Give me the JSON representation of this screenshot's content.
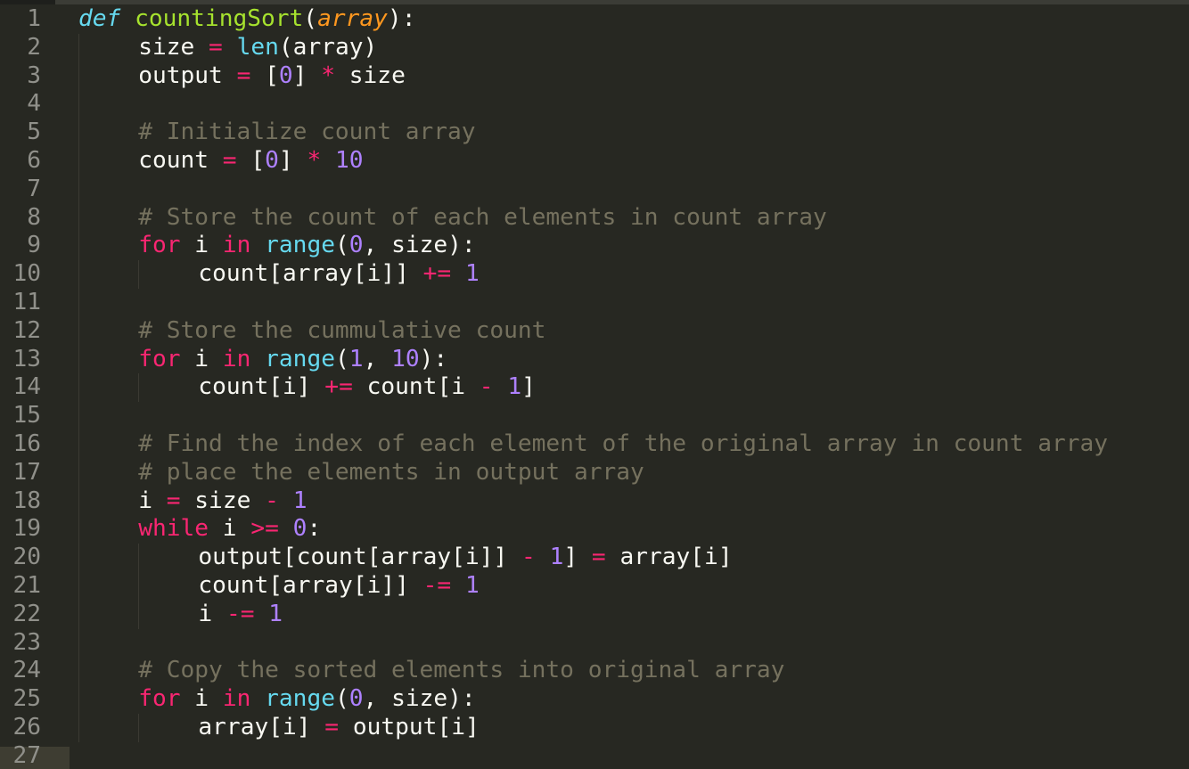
{
  "editor": {
    "theme_colors": {
      "background": "#272822",
      "keyword": "#F92672",
      "function": "#A6E22E",
      "builtin": "#66D9EF",
      "parameter": "#FD971F",
      "number": "#AE81FF",
      "comment": "#75715E",
      "text": "#F8F8F2",
      "line_number": "#90908a"
    },
    "current_line": 27,
    "lines": [
      {
        "n": "1",
        "indent": 0,
        "tokens": [
          [
            "def",
            "def"
          ],
          [
            "tx",
            " "
          ],
          [
            "fn",
            "countingSort"
          ],
          [
            "tx",
            "("
          ],
          [
            "param",
            "array"
          ],
          [
            "tx",
            "):"
          ]
        ]
      },
      {
        "n": "2",
        "indent": 1,
        "tokens": [
          [
            "tx",
            "size "
          ],
          [
            "op",
            "="
          ],
          [
            "tx",
            " "
          ],
          [
            "builtin",
            "len"
          ],
          [
            "tx",
            "(array)"
          ]
        ]
      },
      {
        "n": "3",
        "indent": 1,
        "tokens": [
          [
            "tx",
            "output "
          ],
          [
            "op",
            "="
          ],
          [
            "tx",
            " ["
          ],
          [
            "num",
            "0"
          ],
          [
            "tx",
            "] "
          ],
          [
            "op",
            "*"
          ],
          [
            "tx",
            " size"
          ]
        ]
      },
      {
        "n": "4",
        "indent": 1,
        "tokens": []
      },
      {
        "n": "5",
        "indent": 1,
        "tokens": [
          [
            "cm",
            "# Initialize count array"
          ]
        ]
      },
      {
        "n": "6",
        "indent": 1,
        "tokens": [
          [
            "tx",
            "count "
          ],
          [
            "op",
            "="
          ],
          [
            "tx",
            " ["
          ],
          [
            "num",
            "0"
          ],
          [
            "tx",
            "] "
          ],
          [
            "op",
            "*"
          ],
          [
            "tx",
            " "
          ],
          [
            "num",
            "10"
          ]
        ]
      },
      {
        "n": "7",
        "indent": 1,
        "tokens": []
      },
      {
        "n": "8",
        "indent": 1,
        "tokens": [
          [
            "cm",
            "# Store the count of each elements in count array"
          ]
        ]
      },
      {
        "n": "9",
        "indent": 1,
        "tokens": [
          [
            "kw",
            "for"
          ],
          [
            "tx",
            " i "
          ],
          [
            "kw",
            "in"
          ],
          [
            "tx",
            " "
          ],
          [
            "builtin",
            "range"
          ],
          [
            "tx",
            "("
          ],
          [
            "num",
            "0"
          ],
          [
            "tx",
            ", size):"
          ]
        ]
      },
      {
        "n": "10",
        "indent": 2,
        "tokens": [
          [
            "tx",
            "count[array[i]] "
          ],
          [
            "op",
            "+="
          ],
          [
            "tx",
            " "
          ],
          [
            "num",
            "1"
          ]
        ]
      },
      {
        "n": "11",
        "indent": 1,
        "tokens": []
      },
      {
        "n": "12",
        "indent": 1,
        "tokens": [
          [
            "cm",
            "# Store the cummulative count"
          ]
        ]
      },
      {
        "n": "13",
        "indent": 1,
        "tokens": [
          [
            "kw",
            "for"
          ],
          [
            "tx",
            " i "
          ],
          [
            "kw",
            "in"
          ],
          [
            "tx",
            " "
          ],
          [
            "builtin",
            "range"
          ],
          [
            "tx",
            "("
          ],
          [
            "num",
            "1"
          ],
          [
            "tx",
            ", "
          ],
          [
            "num",
            "10"
          ],
          [
            "tx",
            "):"
          ]
        ]
      },
      {
        "n": "14",
        "indent": 2,
        "tokens": [
          [
            "tx",
            "count[i] "
          ],
          [
            "op",
            "+="
          ],
          [
            "tx",
            " count[i "
          ],
          [
            "op",
            "-"
          ],
          [
            "tx",
            " "
          ],
          [
            "num",
            "1"
          ],
          [
            "tx",
            "]"
          ]
        ]
      },
      {
        "n": "15",
        "indent": 1,
        "tokens": []
      },
      {
        "n": "16",
        "indent": 1,
        "tokens": [
          [
            "cm",
            "# Find the index of each element of the original array in count array"
          ]
        ]
      },
      {
        "n": "17",
        "indent": 1,
        "tokens": [
          [
            "cm",
            "# place the elements in output array"
          ]
        ]
      },
      {
        "n": "18",
        "indent": 1,
        "tokens": [
          [
            "tx",
            "i "
          ],
          [
            "op",
            "="
          ],
          [
            "tx",
            " size "
          ],
          [
            "op",
            "-"
          ],
          [
            "tx",
            " "
          ],
          [
            "num",
            "1"
          ]
        ]
      },
      {
        "n": "19",
        "indent": 1,
        "tokens": [
          [
            "kw",
            "while"
          ],
          [
            "tx",
            " i "
          ],
          [
            "op",
            ">="
          ],
          [
            "tx",
            " "
          ],
          [
            "num",
            "0"
          ],
          [
            "tx",
            ":"
          ]
        ]
      },
      {
        "n": "20",
        "indent": 2,
        "tokens": [
          [
            "tx",
            "output[count[array[i]] "
          ],
          [
            "op",
            "-"
          ],
          [
            "tx",
            " "
          ],
          [
            "num",
            "1"
          ],
          [
            "tx",
            "] "
          ],
          [
            "op",
            "="
          ],
          [
            "tx",
            " array[i]"
          ]
        ]
      },
      {
        "n": "21",
        "indent": 2,
        "tokens": [
          [
            "tx",
            "count[array[i]] "
          ],
          [
            "op",
            "-="
          ],
          [
            "tx",
            " "
          ],
          [
            "num",
            "1"
          ]
        ]
      },
      {
        "n": "22",
        "indent": 2,
        "tokens": [
          [
            "tx",
            "i "
          ],
          [
            "op",
            "-="
          ],
          [
            "tx",
            " "
          ],
          [
            "num",
            "1"
          ]
        ]
      },
      {
        "n": "23",
        "indent": 1,
        "tokens": []
      },
      {
        "n": "24",
        "indent": 1,
        "tokens": [
          [
            "cm",
            "# Copy the sorted elements into original array"
          ]
        ]
      },
      {
        "n": "25",
        "indent": 1,
        "tokens": [
          [
            "kw",
            "for"
          ],
          [
            "tx",
            " i "
          ],
          [
            "kw",
            "in"
          ],
          [
            "tx",
            " "
          ],
          [
            "builtin",
            "range"
          ],
          [
            "tx",
            "("
          ],
          [
            "num",
            "0"
          ],
          [
            "tx",
            ", size):"
          ]
        ]
      },
      {
        "n": "26",
        "indent": 2,
        "tokens": [
          [
            "tx",
            "array[i] "
          ],
          [
            "op",
            "="
          ],
          [
            "tx",
            " output[i]"
          ]
        ]
      },
      {
        "n": "27",
        "indent": 0,
        "tokens": []
      }
    ]
  }
}
